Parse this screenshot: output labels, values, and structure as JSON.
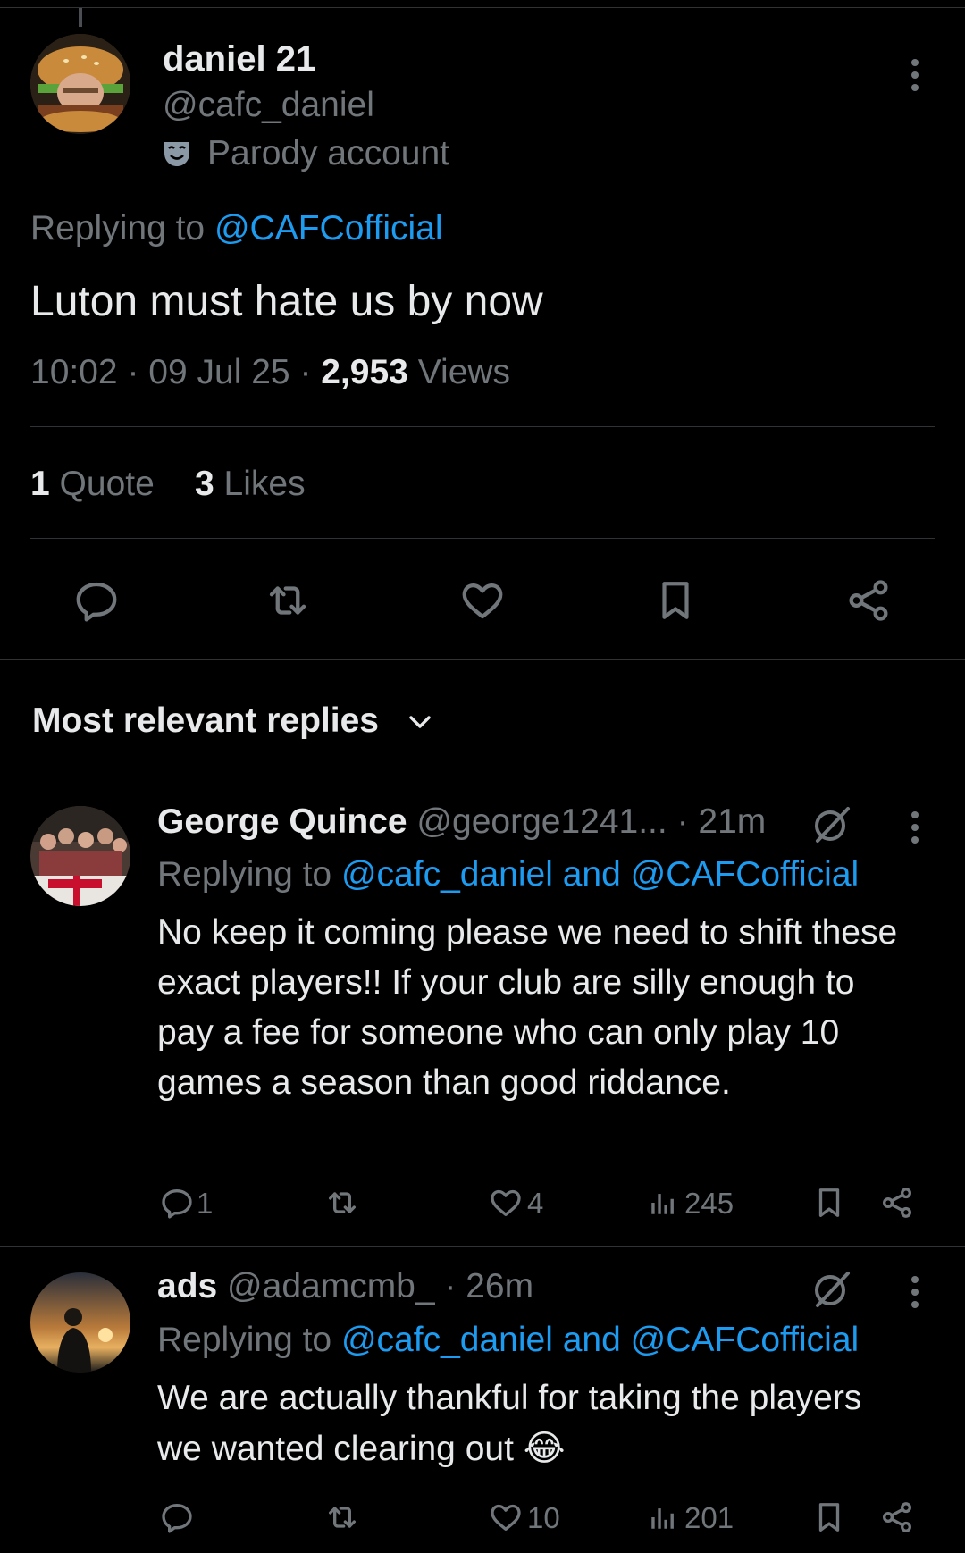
{
  "tweet": {
    "author_name": "daniel 21",
    "author_handle": "@cafc_daniel",
    "parody_label": "Parody account",
    "replying_prefix": "Replying to",
    "replying_to": "@CAFCofficial",
    "text": "Luton must hate us by now",
    "time": "10:02",
    "date": "09 Jul 25",
    "separator": "·",
    "views_count": "2,953",
    "views_label": "Views",
    "quote_count": "1",
    "quote_label": "Quote",
    "likes_count": "3",
    "likes_label": "Likes",
    "actions": [
      "reply-icon",
      "retweet-icon",
      "like-icon",
      "bookmark-icon",
      "share-icon"
    ]
  },
  "replies_section": {
    "title": "Most relevant replies",
    "dropdown_icon": "chevron-down-icon"
  },
  "replies": [
    {
      "name": "George Quince",
      "handle": "@george1241...",
      "time": "· 21m",
      "replying_prefix": "Replying to",
      "replying_to": "@cafc_daniel and @CAFCofficial",
      "text": "No keep it coming please we need to shift these exact players!! If your club are silly enough to pay a fee for someone who can only play 10 games a season than good riddance.",
      "reply_count": "1",
      "retweet_count": "",
      "like_count": "4",
      "view_count": "245"
    },
    {
      "name": "ads",
      "handle": "@adamcmb_",
      "time": "· 26m",
      "replying_prefix": "Replying to",
      "replying_to": "@cafc_daniel and @CAFCofficial",
      "text": "We are actually thankful for taking the players we wanted clearing out",
      "emoji": "😂",
      "reply_count": "",
      "retweet_count": "",
      "like_count": "10",
      "view_count": "201"
    }
  ],
  "colors": {
    "background": "#000000",
    "text": "#e7e9ea",
    "muted": "#71767b",
    "link": "#1d9bf0",
    "divider": "#2f3336"
  }
}
